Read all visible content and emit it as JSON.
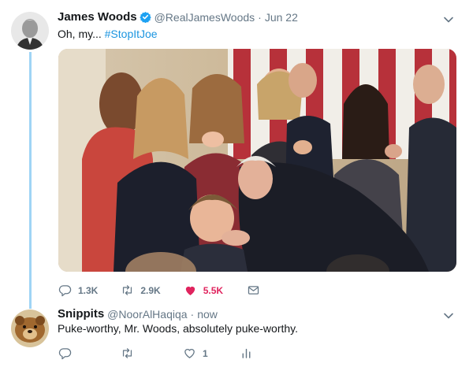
{
  "tweet": {
    "display_name": "James Woods",
    "handle": "@RealJamesWoods",
    "separator": "·",
    "time": "Jun 22",
    "text_prefix": "Oh, my... ",
    "hashtag": "#StopItJoe",
    "actions": {
      "replies": "1.3K",
      "retweets": "2.9K",
      "likes": "5.5K"
    },
    "like_color": "#e0245e"
  },
  "reply": {
    "display_name": "Snippits",
    "handle": "@NoorAlHaqiqa",
    "separator": "·",
    "time": "now",
    "text": "Puke-worthy, Mr. Woods, absolutely puke-worthy.",
    "actions": {
      "likes": "1"
    }
  },
  "colors": {
    "link": "#1b95e0",
    "thread_line": "#9fd4f5",
    "muted": "#657786"
  },
  "icons": [
    "verified-badge-icon",
    "chevron-down-icon",
    "reply-icon",
    "retweet-icon",
    "heart-icon",
    "direct-message-icon",
    "analytics-icon"
  ]
}
